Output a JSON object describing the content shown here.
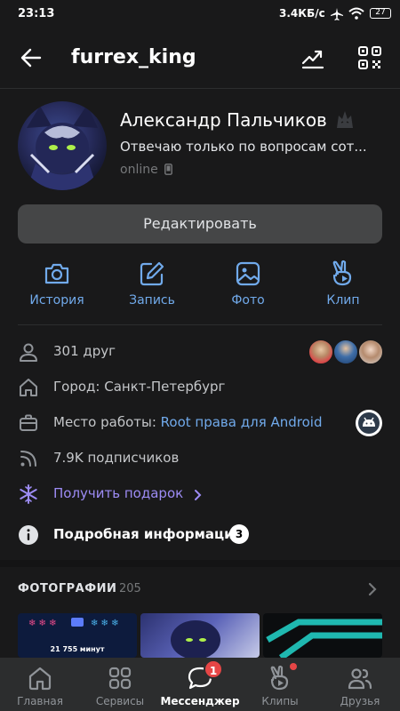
{
  "status_bar": {
    "time": "23:13",
    "speed": "3.4КБ/с",
    "battery": "27"
  },
  "header": {
    "title": "furrex_king"
  },
  "profile": {
    "name": "Александр Пальчиков",
    "status": "Отвечаю только по вопросам сот...",
    "online": "online"
  },
  "edit_button": "Редактировать",
  "actions": [
    {
      "label": "История",
      "icon": "camera-icon"
    },
    {
      "label": "Запись",
      "icon": "edit-icon"
    },
    {
      "label": "Фото",
      "icon": "image-icon"
    },
    {
      "label": "Клип",
      "icon": "clip-icon"
    }
  ],
  "info": {
    "friends": "301 друг",
    "city": "Город: Санкт-Петербург",
    "work_prefix": "Место работы: ",
    "work_link": "Root права для Android",
    "followers": "7.9K подписчиков",
    "gift": "Получить подарок",
    "details": "Подробная информация",
    "details_count": "3"
  },
  "photos": {
    "title": "ФОТОГРАФИИ",
    "count": "205",
    "thumb_caption": "21 755 минут"
  },
  "tabbar": {
    "tabs": [
      "Главная",
      "Сервисы",
      "Мессенджер",
      "Клипы",
      "Друзья"
    ],
    "messenger_badge": "1"
  },
  "colors": {
    "accent": "#71aaeb",
    "background": "#19191a",
    "gift": "#9d8cf5",
    "badge": "#e64646"
  }
}
